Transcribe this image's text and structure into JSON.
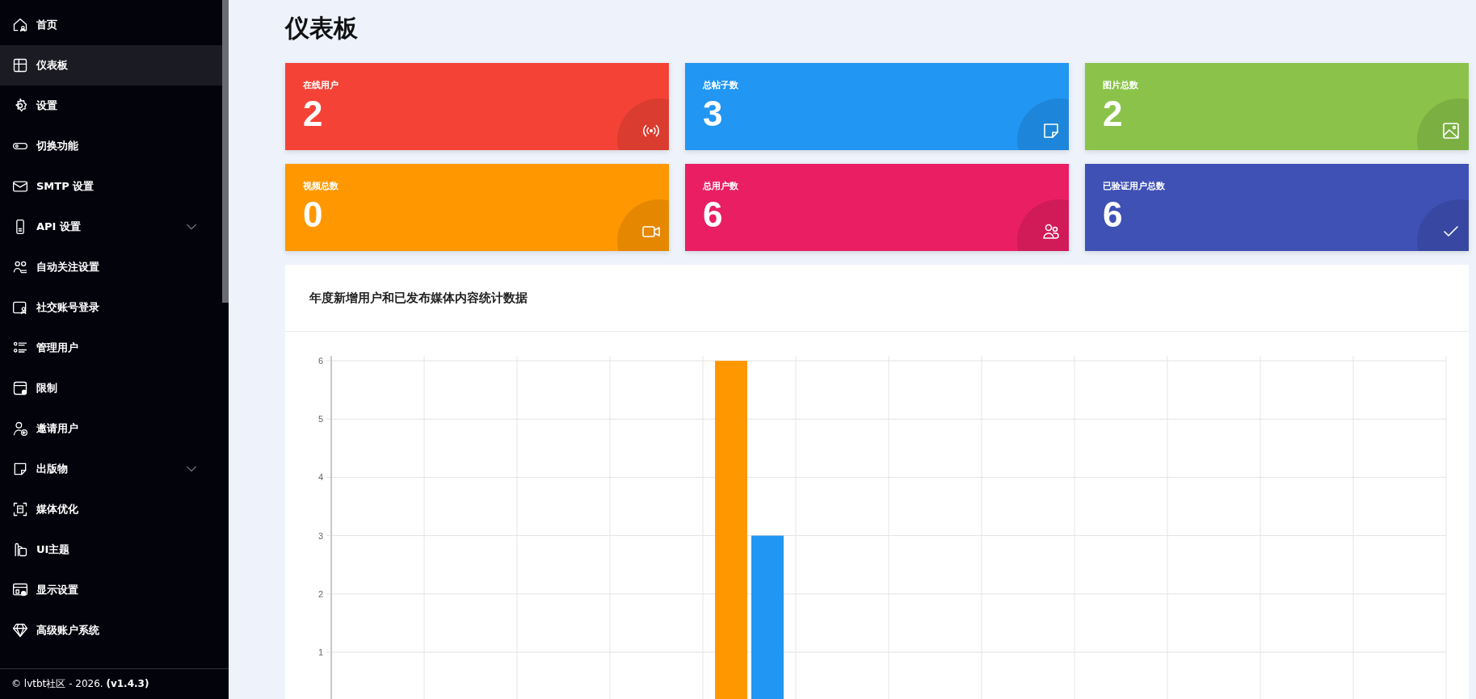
{
  "sidebar": {
    "items": [
      {
        "label": "首页",
        "selected": false
      },
      {
        "label": "仪表板",
        "selected": true
      },
      {
        "label": "设置",
        "selected": false
      },
      {
        "label": "切换功能",
        "selected": false
      },
      {
        "label": "SMTP 设置",
        "selected": false
      },
      {
        "label": "API 设置",
        "selected": false,
        "expanded": false
      },
      {
        "label": "自动关注设置",
        "selected": false
      },
      {
        "label": "社交账号登录",
        "selected": false
      },
      {
        "label": "管理用户",
        "selected": false
      },
      {
        "label": "限制",
        "selected": false
      },
      {
        "label": "邀请用户",
        "selected": false
      },
      {
        "label": "出版物",
        "selected": false,
        "expanded": false
      },
      {
        "label": "媒体优化",
        "selected": false
      },
      {
        "label": "UI主题",
        "selected": false
      },
      {
        "label": "显示设置",
        "selected": false
      },
      {
        "label": "高级账户系统",
        "selected": false
      }
    ],
    "footer": {
      "prefix": "©",
      "link": "lvtbt社区",
      "text": "- 2026. **(v1.4.3)**"
    }
  },
  "page": {
    "title": "仪表板"
  },
  "cards": [
    {
      "label": "在线用户",
      "value": "2",
      "color": "#f44336"
    },
    {
      "label": "总帖子数",
      "value": "3",
      "color": "#2196f3"
    },
    {
      "label": "图片总数",
      "value": "2",
      "color": "#8bc34a"
    },
    {
      "label": "视频总数",
      "value": "0",
      "color": "#ff9800"
    },
    {
      "label": "总用户数",
      "value": "6",
      "color": "#e91e63"
    },
    {
      "label": "已验证用户总数",
      "value": "6",
      "color": "#3f51b5"
    }
  ],
  "chart_panel": {
    "title": "年度新增用户和已发布媒体内容统计数据",
    "chart_data": {
      "type": "bar",
      "grid": true,
      "ylim": [
        0,
        6
      ],
      "yticks": [
        1,
        2,
        3,
        4,
        5,
        6
      ],
      "series": [
        {
          "color": "#ff9800",
          "values": [
            0,
            0,
            0,
            0,
            6,
            0,
            0,
            0,
            0,
            0,
            0,
            0
          ]
        },
        {
          "color": "#2196f3",
          "values": [
            0,
            0,
            0,
            0,
            3,
            0,
            0,
            0,
            0,
            0,
            0,
            0
          ]
        }
      ]
    }
  }
}
